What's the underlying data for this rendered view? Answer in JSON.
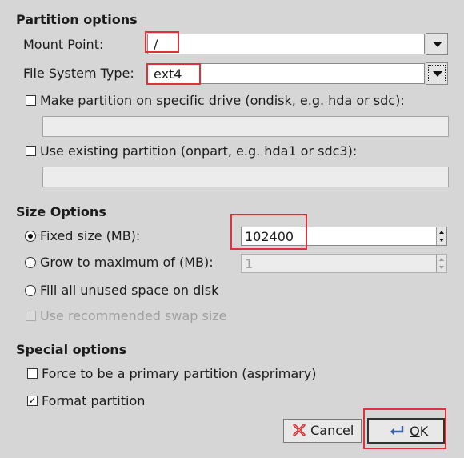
{
  "partition_options": {
    "title": "Partition options",
    "mount_point": {
      "label": "Mount Point:",
      "value": "/"
    },
    "fs_type": {
      "label": "File System Type:",
      "value": "ext4"
    },
    "ondisk": {
      "label": "Make partition on specific drive (ondisk, e.g. hda or sdc):",
      "checked": false,
      "value": ""
    },
    "onpart": {
      "label": "Use existing partition (onpart, e.g. hda1 or sdc3):",
      "checked": false,
      "value": ""
    }
  },
  "size_options": {
    "title": "Size Options",
    "fixed": {
      "label": "Fixed size (MB):",
      "value": "102400",
      "selected": true
    },
    "grow": {
      "label": "Grow to maximum of (MB):",
      "value": "1",
      "selected": false
    },
    "fill": {
      "label": "Fill all unused space on disk",
      "selected": false
    },
    "swap": {
      "label": "Use recommended swap size",
      "checked": false,
      "enabled": false
    }
  },
  "special_options": {
    "title": "Special options",
    "primary": {
      "label": "Force to be a primary partition (asprimary)",
      "checked": false
    },
    "format": {
      "label": "Format partition",
      "checked": true
    }
  },
  "buttons": {
    "cancel": {
      "mnemonic": "C",
      "rest": "ancel",
      "icon": "cancel-x-icon",
      "icon_color": "#d11a1a"
    },
    "ok": {
      "mnemonic": "O",
      "rest": "K",
      "icon": "return-arrow-icon",
      "icon_color": "#3b63a8"
    }
  },
  "highlight_color": "#e0303a"
}
